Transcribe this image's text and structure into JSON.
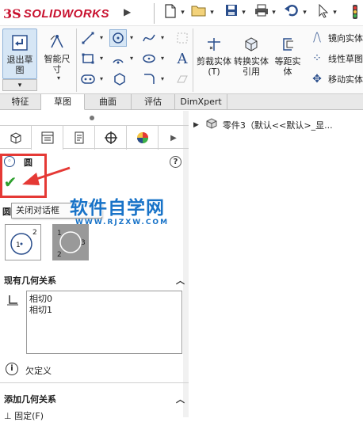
{
  "app": {
    "logo_prefix": "3S",
    "logo_text": "SOLIDWORKS"
  },
  "titlebar": {
    "icons": [
      "new-document-icon",
      "open-folder-icon",
      "save-icon",
      "print-icon",
      "undo-icon",
      "select-pointer-icon",
      "rebuild-icon"
    ]
  },
  "ribbon": {
    "exit_sketch": "退出草图",
    "smart_dimension": "智能尺寸",
    "trim_entities": "剪裁实体(T)",
    "convert_entities": "转换实体引用",
    "offset_entities": "等距实体",
    "mirror_entities": "镜向实体",
    "linear_pattern": "线性草图",
    "move_entities": "移动实体",
    "text_tool": "A"
  },
  "tabs": [
    "特征",
    "草图",
    "曲面",
    "评估",
    "DimXpert"
  ],
  "active_tab": 1,
  "property_manager": {
    "title": "圆",
    "help_symbol": "?",
    "ok_symbol": "✔",
    "tooltip": "关闭对话框",
    "circle_type_label": "圆",
    "existing_relations_header": "现有几何关系",
    "relations": [
      "相切0",
      "相切1"
    ],
    "status": "欠定义",
    "add_relations_header": "添加几何关系",
    "bottom_item": "固定(F)",
    "circle_option_1": "1",
    "circle_option_2": "2",
    "circle_option_3_labels": [
      "1",
      "2",
      "3"
    ]
  },
  "watermark": {
    "main": "软件自学网",
    "sub": "WWW.RJZXW.COM"
  },
  "tree": {
    "root_label": "零件3（默认<<默认>_显..."
  },
  "colors": {
    "accent_red": "#e53935",
    "watermark_blue": "#1873c8",
    "ok_green": "#2ea02e",
    "brand_red": "#c8102e"
  }
}
